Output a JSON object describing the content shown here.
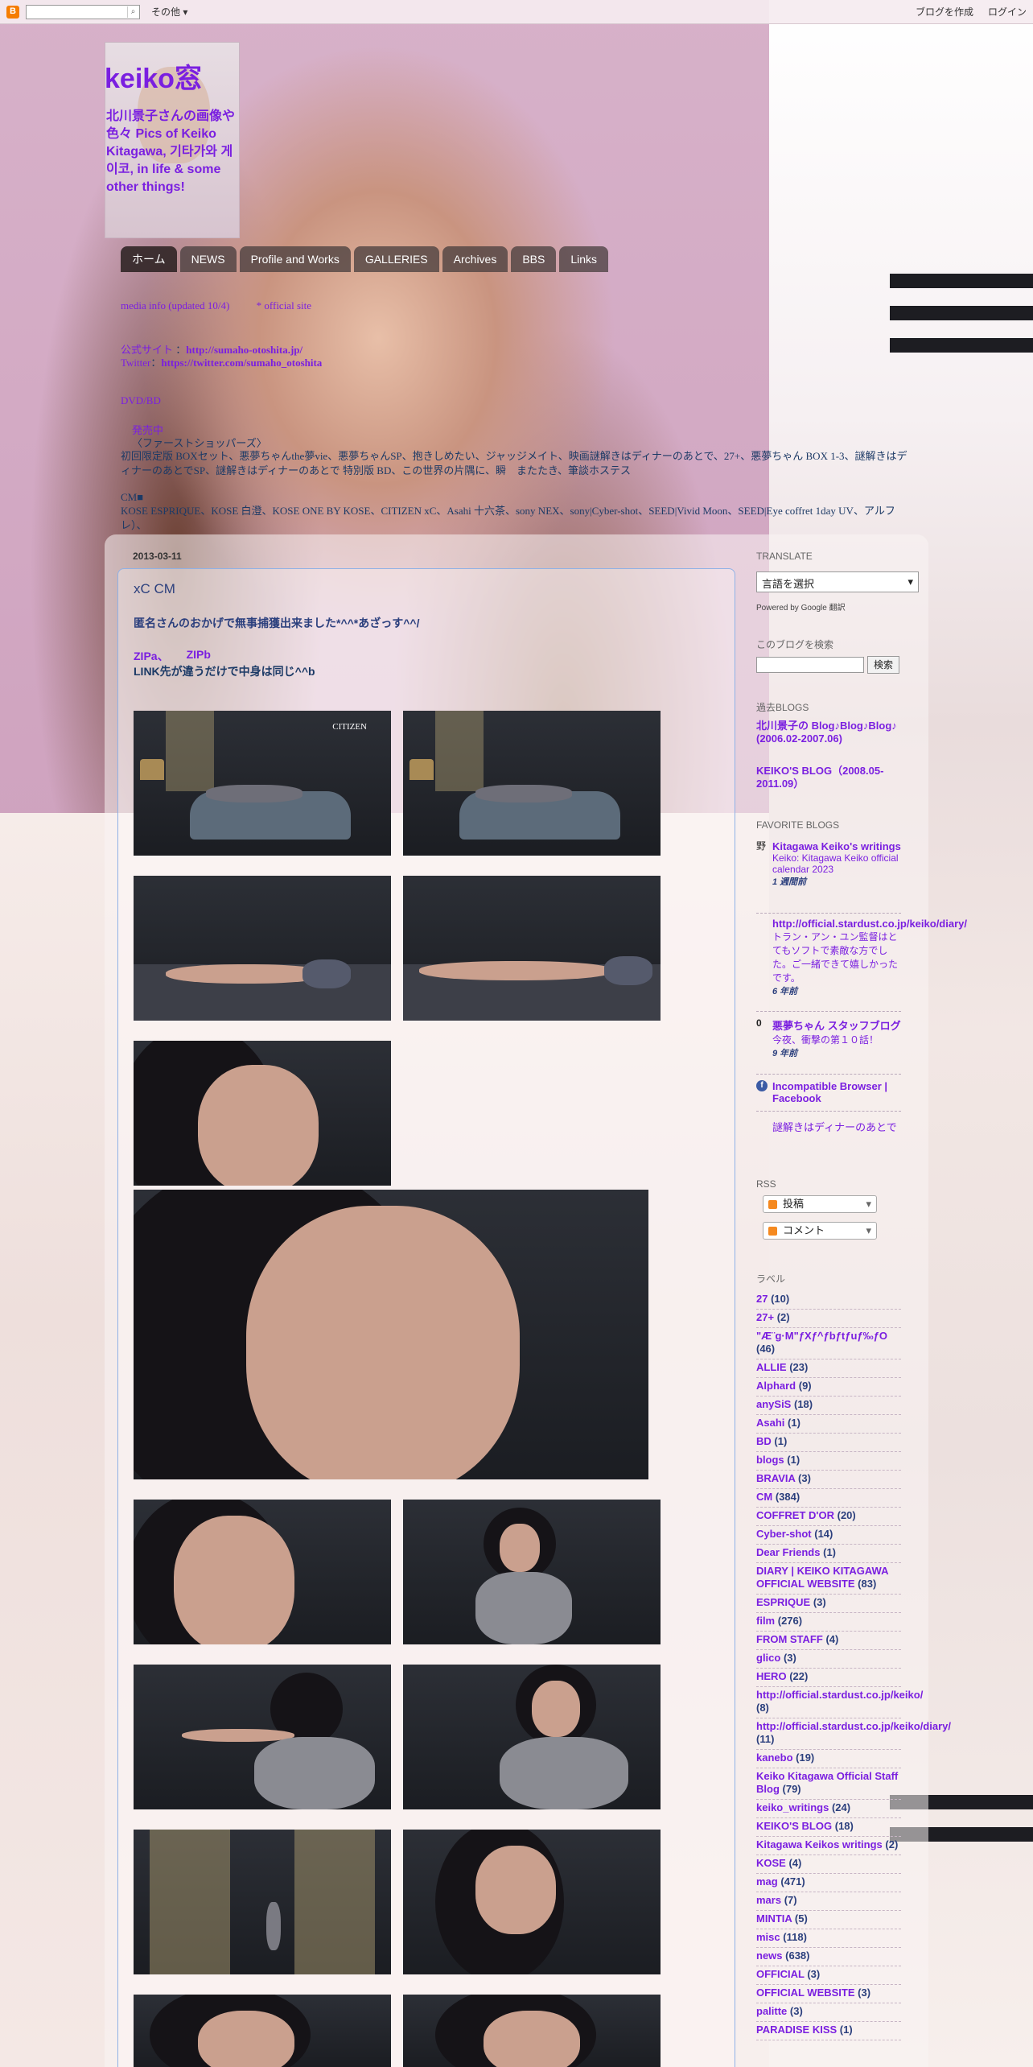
{
  "navbar": {
    "more": "その他",
    "create_blog": "ブログを作成",
    "login": "ログイン"
  },
  "header": {
    "title": "keiko窓",
    "description": "北川景子さんの画像や色々 Pics of Keiko Kitagawa, 기타가와 게이코, in life & some other things!"
  },
  "tabs": [
    "ホーム",
    "NEWS",
    "Profile and Works",
    "GALLERIES",
    "Archives",
    "BBS",
    "Links"
  ],
  "info": {
    "media_info": "media info (updated 10/4)",
    "official": "* official site",
    "official_site_label": "公式サイト",
    "official_url": "http://sumaho-otoshita.jp/",
    "twitter_label": "Twitter",
    "twitter_url": "https://twitter.com/sumaho_otoshita",
    "dvd_label": "DVD/BD",
    "dvd_sub": "発売中",
    "dvd_title": "〈ファーストショッパーズ〉",
    "dvd_list": "初回限定版 BOXセット、悪夢ちゃんthe夢vie、悪夢ちゃんSP、抱きしめたい、ジャッジメイト、映画謎解きはディナーのあとで、27+、悪夢ちゃん BOX 1-3、謎解きはディナーのあとでSP、謎解きはディナーのあとで 特別版 BD、この世界の片隅に、瞬　またたき、筆談ホステス",
    "cm_label": "CM■",
    "cm_list": "KOSE ESPRIQUE、KOSE 白澄、KOSE ONE BY KOSE、CITIZEN xC、Asahi 十六茶、sony NEX、sony|Cyber-shot、SEED|Vivid Moon、SEED|Eye coffret 1day UV、アルフレ）、"
  },
  "post": {
    "date": "2013-03-11",
    "title": "xC CM",
    "line1": "匿名さんのおかげで無事捕獲出来ました*^^*あざっす^^/",
    "link_a": "ZIPa、",
    "link_b": "ZIPb",
    "line2": "LINK先が違うだけで中身は同じ^^b",
    "citizen_caption": "CITIZEN"
  },
  "sidebar": {
    "translate_head": "TRANSLATE",
    "translate_select": "言語を選択",
    "powered": "Powered by Google 翻訳",
    "search_head": "このブログを検索",
    "search_button": "検索",
    "past_head": "過去BLOGS",
    "past_1": "北川景子の Blog♪Blog♪Blog♪ (2006.02-2007.06)",
    "past_2": "KEIKO'S BLOG（2008.05-2011.09）",
    "fav_head": "FAVORITE BLOGS",
    "fav": [
      {
        "icon": "野",
        "title": "Kitagawa Keiko's writings",
        "sub": "Keiko: Kitagawa Keiko official calendar 2023",
        "age": "1 週間前"
      },
      {
        "icon": "",
        "title": "http://official.stardust.co.jp/keiko/diary/",
        "sub": "トラン・アン・ユン監督はとてもソフトで素敵な方でした。ご一緒できて嬉しかったです。",
        "age": "6 年前"
      },
      {
        "icon": "0",
        "title": "悪夢ちゃん スタッフブログ",
        "sub": "今夜、衝撃の第１０話！",
        "age": "9 年前"
      },
      {
        "icon": "f",
        "title": "Incompatible Browser | Facebook",
        "sub": "",
        "age": ""
      },
      {
        "icon": "",
        "title": "謎解きはディナーのあとで",
        "sub": "",
        "age": ""
      }
    ],
    "rss_head": "RSS",
    "rss_posts": "投稿",
    "rss_comments": "コメント",
    "labels_head": "ラベル",
    "labels": [
      {
        "name": "27",
        "count": "(10)"
      },
      {
        "name": "27+",
        "count": "(2)"
      },
      {
        "name": "\"Æ¨g·M\"ƒXƒ^ƒbƒtƒuƒ‰ƒO",
        "count": "(46)"
      },
      {
        "name": "ALLIE",
        "count": "(23)"
      },
      {
        "name": "Alphard",
        "count": "(9)"
      },
      {
        "name": "anySiS",
        "count": "(18)"
      },
      {
        "name": "Asahi",
        "count": "(1)"
      },
      {
        "name": "BD",
        "count": "(1)"
      },
      {
        "name": "blogs",
        "count": "(1)"
      },
      {
        "name": "BRAVIA",
        "count": "(3)"
      },
      {
        "name": "CM",
        "count": "(384)"
      },
      {
        "name": "COFFRET D'OR",
        "count": "(20)"
      },
      {
        "name": "Cyber-shot",
        "count": "(14)"
      },
      {
        "name": "Dear Friends",
        "count": "(1)"
      },
      {
        "name": "DIARY | KEIKO KITAGAWA OFFICIAL WEBSITE",
        "count": "(83)"
      },
      {
        "name": "ESPRIQUE",
        "count": "(3)"
      },
      {
        "name": "film",
        "count": "(276)"
      },
      {
        "name": "FROM STAFF",
        "count": "(4)"
      },
      {
        "name": "glico",
        "count": "(3)"
      },
      {
        "name": "HERO",
        "count": "(22)"
      },
      {
        "name": "http://official.stardust.co.jp/keiko/",
        "count": "(8)"
      },
      {
        "name": "http://official.stardust.co.jp/keiko/diary/",
        "count": "(11)"
      },
      {
        "name": "kanebo",
        "count": "(19)"
      },
      {
        "name": "Keiko Kitagawa Official Staff Blog",
        "count": "(79)"
      },
      {
        "name": "keiko_writings",
        "count": "(24)"
      },
      {
        "name": "KEIKO'S BLOG",
        "count": "(18)"
      },
      {
        "name": "Kitagawa Keikos writings",
        "count": "(2)"
      },
      {
        "name": "KOSE",
        "count": "(4)"
      },
      {
        "name": "mag",
        "count": "(471)"
      },
      {
        "name": "mars",
        "count": "(7)"
      },
      {
        "name": "MINTIA",
        "count": "(5)"
      },
      {
        "name": "misc",
        "count": "(118)"
      },
      {
        "name": "news",
        "count": "(638)"
      },
      {
        "name": "OFFICIAL",
        "count": "(3)"
      },
      {
        "name": "OFFICIAL WEBSITE",
        "count": "(3)"
      },
      {
        "name": "palitte",
        "count": "(3)"
      },
      {
        "name": "PARADISE KISS",
        "count": "(1)"
      }
    ]
  }
}
